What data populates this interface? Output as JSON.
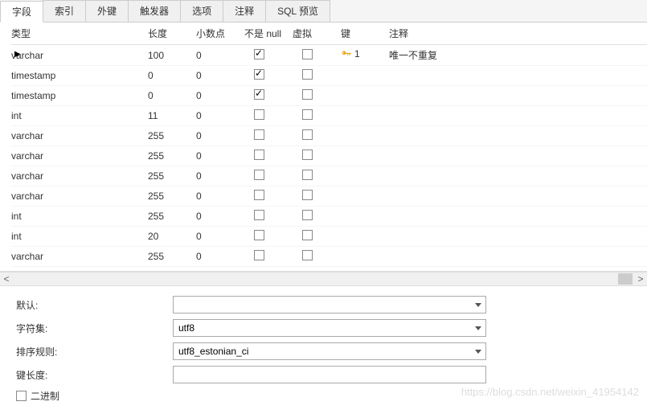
{
  "tabs": [
    "字段",
    "索引",
    "外键",
    "触发器",
    "选项",
    "注释",
    "SQL 预览"
  ],
  "active_tab": 0,
  "columns": {
    "type": "类型",
    "length": "长度",
    "decimals": "小数点",
    "not_null": "不是 null",
    "virtual": "虚拟",
    "key": "键",
    "comment": "注释"
  },
  "rows": [
    {
      "type": "varchar",
      "length": "100",
      "decimals": "0",
      "not_null": true,
      "virtual": false,
      "key": "1",
      "comment": "唯一不重复",
      "current": true
    },
    {
      "type": "timestamp",
      "length": "0",
      "decimals": "0",
      "not_null": true,
      "virtual": false,
      "key": "",
      "comment": ""
    },
    {
      "type": "timestamp",
      "length": "0",
      "decimals": "0",
      "not_null": true,
      "virtual": false,
      "key": "",
      "comment": ""
    },
    {
      "type": "int",
      "length": "11",
      "decimals": "0",
      "not_null": false,
      "virtual": false,
      "key": "",
      "comment": ""
    },
    {
      "type": "varchar",
      "length": "255",
      "decimals": "0",
      "not_null": false,
      "virtual": false,
      "key": "",
      "comment": ""
    },
    {
      "type": "varchar",
      "length": "255",
      "decimals": "0",
      "not_null": false,
      "virtual": false,
      "key": "",
      "comment": ""
    },
    {
      "type": "varchar",
      "length": "255",
      "decimals": "0",
      "not_null": false,
      "virtual": false,
      "key": "",
      "comment": ""
    },
    {
      "type": "varchar",
      "length": "255",
      "decimals": "0",
      "not_null": false,
      "virtual": false,
      "key": "",
      "comment": ""
    },
    {
      "type": "int",
      "length": "255",
      "decimals": "0",
      "not_null": false,
      "virtual": false,
      "key": "",
      "comment": ""
    },
    {
      "type": "int",
      "length": "20",
      "decimals": "0",
      "not_null": false,
      "virtual": false,
      "key": "",
      "comment": ""
    },
    {
      "type": "varchar",
      "length": "255",
      "decimals": "0",
      "not_null": false,
      "virtual": false,
      "key": "",
      "comment": ""
    }
  ],
  "props": {
    "default_label": "默认:",
    "default_value": "",
    "charset_label": "字符集:",
    "charset_value": "utf8",
    "collation_label": "排序规则:",
    "collation_value": "utf8_estonian_ci",
    "key_length_label": "键长度:",
    "key_length_value": "",
    "binary_label": "二进制",
    "binary_checked": false
  },
  "watermark": "https://blog.csdn.net/weixin_41954142"
}
